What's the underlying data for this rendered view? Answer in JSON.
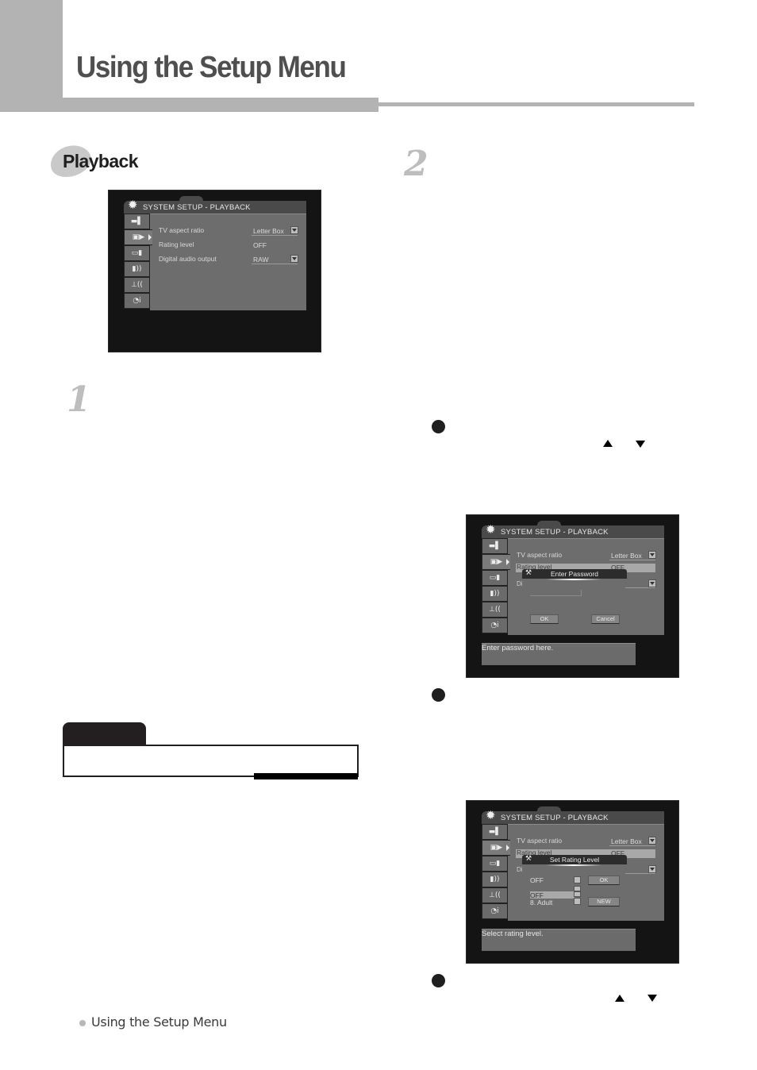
{
  "header": {
    "title": "Using the Setup Menu"
  },
  "section": {
    "title": "Playback"
  },
  "steps": [
    {
      "number": "1"
    },
    {
      "number": "2"
    }
  ],
  "footer": {
    "text": "Using the Setup Menu"
  },
  "icons": {
    "gear": "✹",
    "wrench": "⚒"
  },
  "osd_screens": [
    {
      "title": "SYSTEM SETUP - PLAYBACK",
      "sidebar": [
        {
          "icon": "tv-screen-icon",
          "glyph": "▬▌"
        },
        {
          "icon": "playback-camera-icon",
          "glyph": "▣▶",
          "active": true
        },
        {
          "icon": "video-output-icon",
          "glyph": "▭▮"
        },
        {
          "icon": "audio-speaker-icon",
          "glyph": "▮))"
        },
        {
          "icon": "antenna-icon",
          "glyph": "⊥(("
        },
        {
          "icon": "clock-info-icon",
          "glyph": "◔i"
        }
      ],
      "rows": [
        {
          "label": "TV aspect ratio",
          "value": "Letter Box",
          "dropdown": true
        },
        {
          "label": "Rating level",
          "value": "OFF",
          "dropdown": false
        },
        {
          "label": "Digital audio output",
          "value": "RAW",
          "dropdown": true
        }
      ]
    },
    {
      "title": "SYSTEM SETUP - PLAYBACK",
      "rows": [
        {
          "label": "TV aspect ratio",
          "value": "Letter Box",
          "dropdown": true
        },
        {
          "label": "Rating level",
          "value": "OFF",
          "dropdown": false
        },
        {
          "label": "Di",
          "value": "",
          "dropdown": true
        }
      ],
      "dialog": {
        "title": "Enter Password",
        "buttons": {
          "ok": "OK",
          "cancel": "Cancel"
        }
      },
      "hint": "Enter password here."
    },
    {
      "title": "SYSTEM SETUP - PLAYBACK",
      "rows": [
        {
          "label": "TV aspect ratio",
          "value": "Letter Box",
          "dropdown": true
        },
        {
          "label": "Rating level",
          "value": "OFF",
          "dropdown": false
        },
        {
          "label": "Di",
          "value": "",
          "dropdown": true
        }
      ],
      "dialog": {
        "title": "Set Rating Level",
        "selected": "OFF",
        "options": [
          "OFF",
          "8. Adult"
        ],
        "buttons": {
          "ok": "OK",
          "new": "NEW"
        }
      },
      "hint": "Select rating level."
    }
  ]
}
